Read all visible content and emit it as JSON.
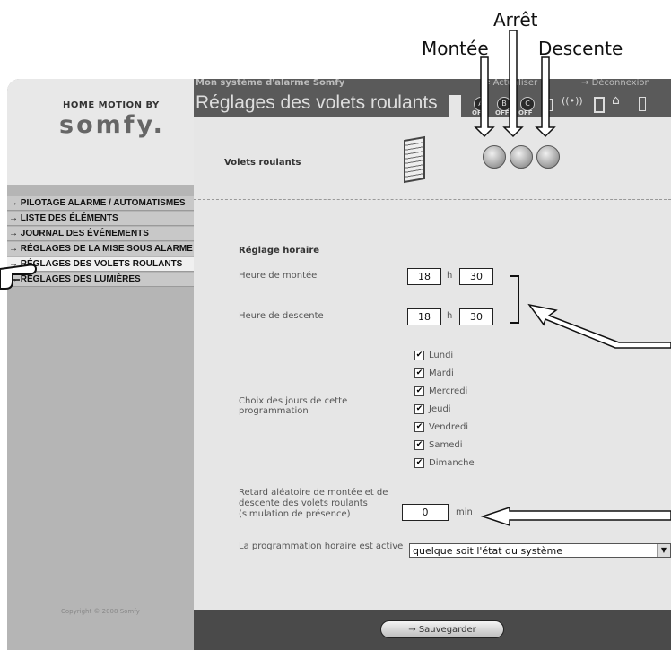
{
  "callouts": {
    "montee": "Montée",
    "arret": "Arrêt",
    "descente": "Descente"
  },
  "header": {
    "system_title": "Mon système d'alarme Somfy",
    "refresh_label": "Actualiser",
    "logout_label": "Déconnexion",
    "page_title": "Réglages des volets roulants",
    "status_off_1": "OFF",
    "status_off_2": "OFF",
    "status_off_3": "OFF"
  },
  "logo": {
    "small": "HOME MOTION BY",
    "big": "somfy."
  },
  "sidebar": {
    "items": [
      {
        "label": "PILOTAGE ALARME / AUTOMATISMES"
      },
      {
        "label": "LISTE DES ÉLÉMENTS"
      },
      {
        "label": "JOURNAL DES ÉVÉNEMENTS"
      },
      {
        "label": "RÉGLAGES DE LA MISE SOUS ALARME"
      },
      {
        "label": "RÉGLAGES DES VOLETS ROULANTS"
      },
      {
        "label": "RÉGLAGES DES LUMIÈRES"
      }
    ],
    "copyright": "Copyright © 2008 Somfy"
  },
  "content": {
    "shutters_label": "Volets roulants",
    "section_title": "Réglage horaire",
    "up_time_label": "Heure de montée",
    "down_time_label": "Heure de descente",
    "up_hour": "18",
    "up_min": "30",
    "down_hour": "18",
    "down_min": "30",
    "h_sep": "h",
    "days_label": "Choix des jours de cette programmation",
    "days": [
      "Lundi",
      "Mardi",
      "Mercredi",
      "Jeudi",
      "Vendredi",
      "Samedi",
      "Dimanche"
    ],
    "check_mark": "✔",
    "random_delay_label": "Retard aléatoire de montée et de descente des volets roulants (simulation de présence)",
    "random_delay_value": "0",
    "random_delay_unit": "min",
    "program_active_label": "La programmation horaire est active",
    "program_active_value": "quelque soit l'état du système"
  },
  "footer": {
    "save_label": "Sauvegarder"
  }
}
